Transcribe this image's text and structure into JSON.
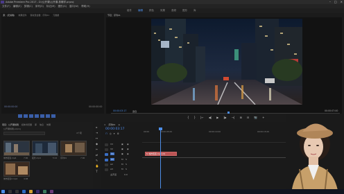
{
  "window": {
    "title": "Adobe Premiere Pro 2017 - D:\\公开课\\公开课-剪辑学.prproj",
    "controls": [
      "–",
      "□",
      "×"
    ]
  },
  "menu": [
    "文件(F)",
    "编辑(E)",
    "剪辑(C)",
    "序列(S)",
    "标记(M)",
    "图形(G)",
    "窗口(W)",
    "帮助(H)"
  ],
  "workspaces": [
    {
      "label": "组件",
      "active": false
    },
    {
      "label": "编辑",
      "active": true
    },
    {
      "label": "颜色",
      "active": false
    },
    {
      "label": "效果",
      "active": false
    },
    {
      "label": "音频",
      "active": false
    },
    {
      "label": "图形",
      "active": false
    },
    {
      "label": "库",
      "active": false
    }
  ],
  "source_panel": {
    "tabs": [
      "源：(无剪辑)",
      "效果控件",
      "音轨混合器：序列01",
      "元数据"
    ],
    "active_tab": 0,
    "timecode_left": "00:00:00:00",
    "timecode_right": "00:00:00:00"
  },
  "program_panel": {
    "tab": "节目：序列01",
    "timecode": "00:00:03:17",
    "fit": "适合",
    "duration": "00:00:07:00"
  },
  "transport": [
    "{",
    "}",
    "|←",
    "◀|",
    "▶",
    "|▶",
    "→|",
    "⊞",
    "⊟",
    "📷",
    "+"
  ],
  "project_panel": {
    "tabs": [
      "项目：公开课剪辑",
      "媒体浏览器",
      "库",
      "信息",
      "效果"
    ],
    "active_tab": 0,
    "file": "公开课剪辑.prproj",
    "count": "4个项",
    "items": [
      {
        "label": "城市街道.mp4",
        "duration": "7:00"
      },
      {
        "label": "夜景.mp4",
        "duration": "5:12"
      },
      {
        "label": "序列01",
        "duration": "7:00"
      },
      {
        "label": "城市街道2.mp4",
        "duration": "4:08"
      }
    ]
  },
  "tools": [
    "▸",
    "⇥",
    "↔",
    "◆",
    "✂",
    "⇄",
    "✎",
    "✋",
    "T"
  ],
  "timeline": {
    "tabs": [
      "×",
      "序列01",
      "≡"
    ],
    "timecode": "00:00:03:17",
    "ruler": [
      "00:00",
      "00:00:05:00",
      "00:00:10:00",
      "00:00:15:00"
    ],
    "video_tracks": [
      "V3",
      "V2",
      "V1"
    ],
    "audio_tracks": [
      "A1",
      "A2",
      "A3"
    ],
    "clip_label": "fx 城市街道.mp4 [V]",
    "master": "主声道",
    "master_value": "0.0"
  },
  "taskbar_time": "10:23",
  "accent": "#4d8ee8"
}
